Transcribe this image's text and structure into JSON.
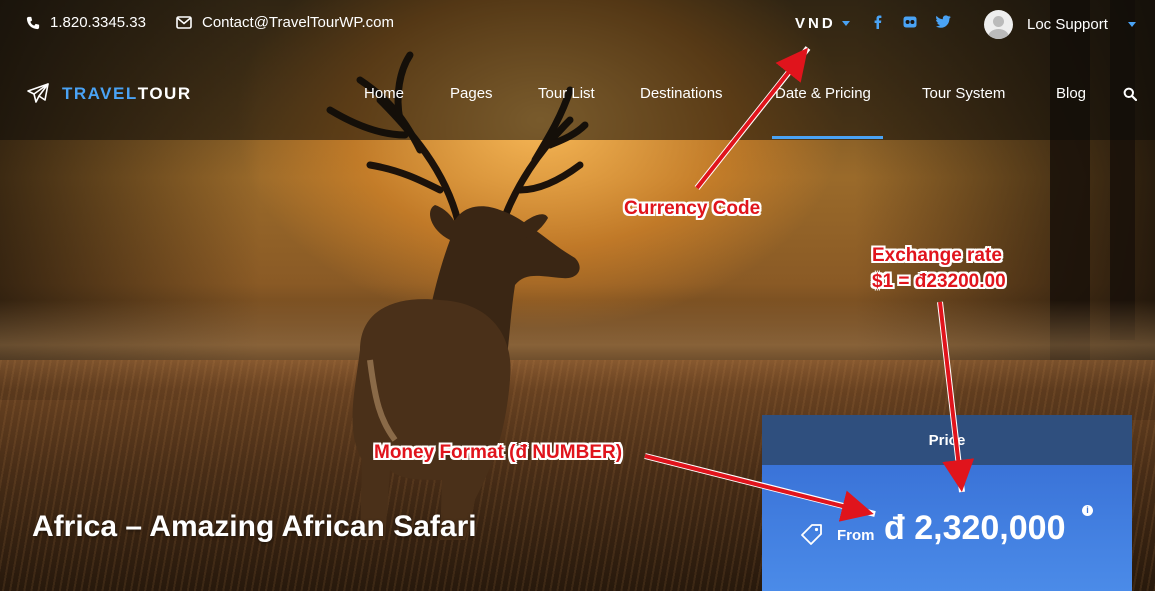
{
  "topbar": {
    "phone": "1.820.3345.33",
    "email": "Contact@TravelTourWP.com",
    "currency": "VND",
    "social": [
      "facebook-icon",
      "flickr-icon",
      "twitter-icon"
    ],
    "user_name": "Loc Support"
  },
  "logo": {
    "part1": "TRAVEL",
    "part2": "TOUR"
  },
  "menu": [
    {
      "label": "Home"
    },
    {
      "label": "Pages"
    },
    {
      "label": "Tour List"
    },
    {
      "label": "Destinations"
    },
    {
      "label": "Date & Pricing"
    },
    {
      "label": "Tour System"
    },
    {
      "label": "Blog"
    }
  ],
  "active_menu": "Date & Pricing",
  "tour_title": "Africa – Amazing African Safari",
  "price": {
    "header": "Price",
    "from_label": "From",
    "amount": "đ 2,320,000"
  },
  "annotations": {
    "currency_code": "Currency Code",
    "exchange_rate_line1": "Exchange rate",
    "exchange_rate_line2": "$1 = đ23200.00",
    "money_format": "Money Format (đ NUMBER)"
  },
  "colors": {
    "accent": "#4aa3f5",
    "price_header": "#2f4f7e",
    "price_body": "#4b8be8",
    "annotation": "#e0141c"
  }
}
